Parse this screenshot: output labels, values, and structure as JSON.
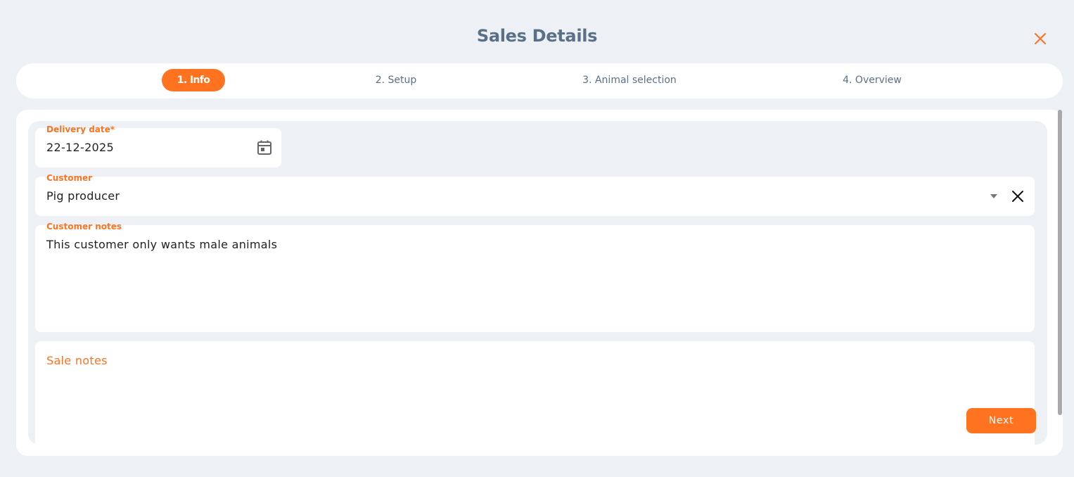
{
  "dialog": {
    "title": "Sales Details"
  },
  "stepper": {
    "steps": [
      {
        "label": "1. Info",
        "active": true
      },
      {
        "label": "2. Setup",
        "active": false
      },
      {
        "label": "3. Animal selection",
        "active": false
      },
      {
        "label": "4. Overview",
        "active": false
      }
    ]
  },
  "form": {
    "delivery_date": {
      "label": "Delivery date*",
      "value": "22-12-2025"
    },
    "customer": {
      "label": "Customer",
      "value": "Pig producer"
    },
    "customer_notes": {
      "label": "Customer notes",
      "value": "This customer only wants male animals"
    },
    "sale_notes": {
      "label": "Sale notes",
      "value": ""
    }
  },
  "actions": {
    "next_label": "Next"
  },
  "colors": {
    "accent": "#ff7220",
    "title": "#5a7088",
    "background": "#edf1f5",
    "surface": "#ffffff"
  },
  "icons": {
    "close": "close-icon",
    "calendar": "calendar-icon",
    "dropdown": "caret-down-icon",
    "clear": "clear-icon"
  }
}
